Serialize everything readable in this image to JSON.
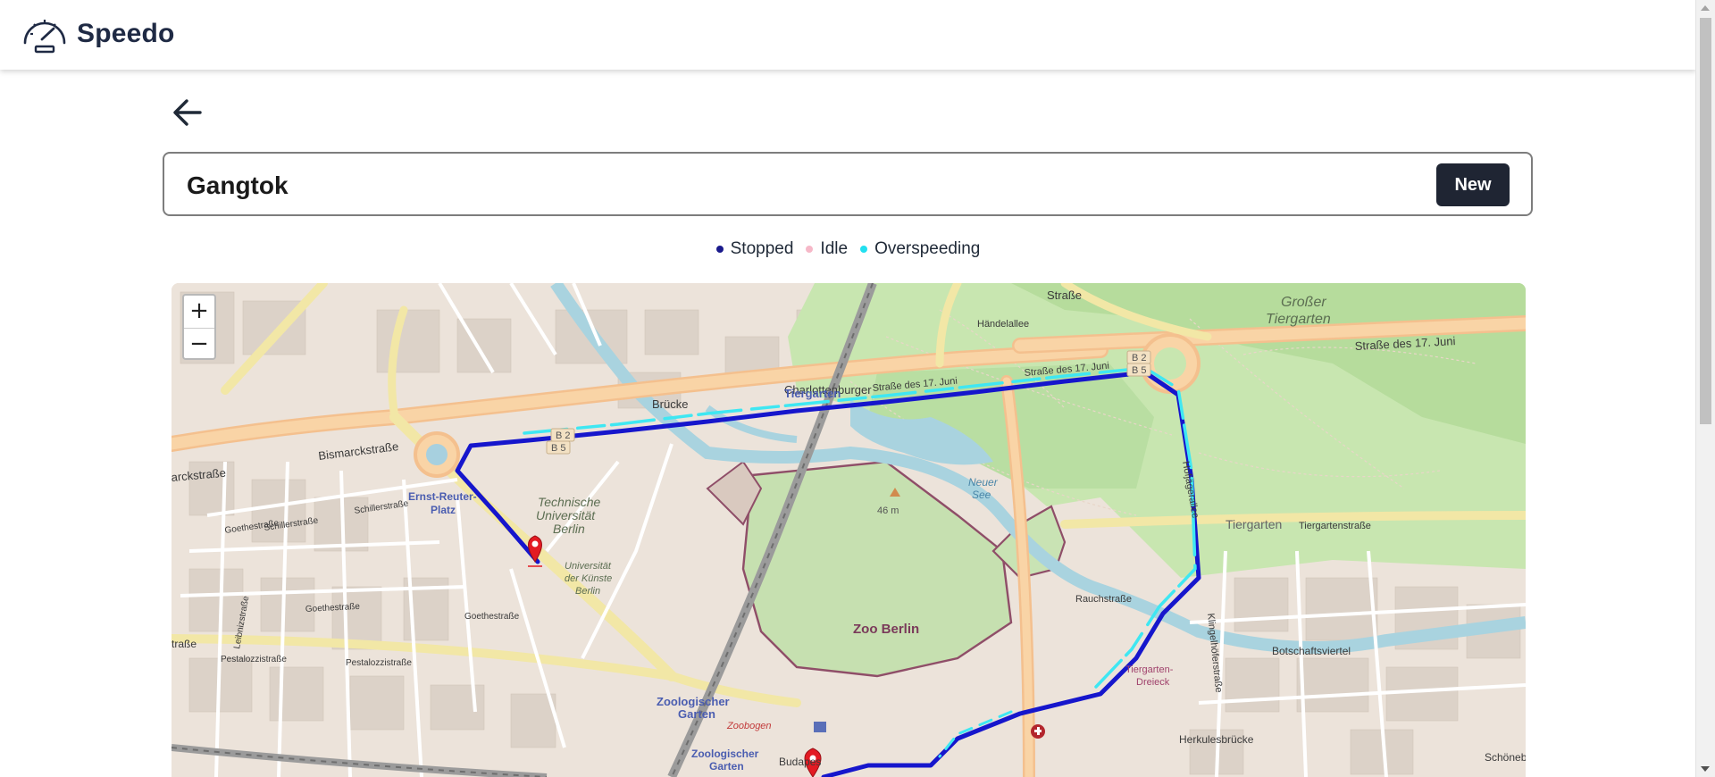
{
  "app": {
    "brand": "Speedo",
    "logo_icon": "speedometer-icon"
  },
  "nav": {
    "back_icon": "arrow-left-icon"
  },
  "search": {
    "value": "Gangtok",
    "new_button": "New"
  },
  "legend": [
    {
      "label": "Stopped",
      "color": "#1a1a8c"
    },
    {
      "label": "Idle",
      "color": "#f6b8c8"
    },
    {
      "label": "Overspeeding",
      "color": "#22e0f0"
    }
  ],
  "map": {
    "zoom_in": "+",
    "zoom_out": "−",
    "route_colors": {
      "stopped": "#0b20c8",
      "overspeeding": "#3ee7f2"
    },
    "marker_color": "#e31b23",
    "labels": {
      "tiergarten_station": "Tiergarten",
      "grosser_tiergarten_1": "Großer",
      "grosser_tiergarten_2": "Tiergarten",
      "str17juni_east": "Straße des 17. Juni",
      "str17juni_mid": "Straße des 17. Juni",
      "str17juni_west": "Straße des 17. Juni",
      "charlottenburger_1": "Charlottenburger",
      "charlottenburger_2": "Brücke",
      "bismarckstr": "Bismarckstraße",
      "bismarckstr_cut": "arckstraße",
      "ernst_reuter_1": "Ernst-Reuter-",
      "ernst_reuter_2": "Platz",
      "tu_1": "Technische",
      "tu_2": "Universität",
      "tu_3": "Berlin",
      "udk_1": "Universität",
      "udk_2": "der Künste",
      "udk_3": "Berlin",
      "neuer_see_1": "Neuer",
      "neuer_see_2": "See",
      "height": "46 m",
      "zoo_berlin": "Zoo Berlin",
      "zoo_garten_1": "Zoologischer",
      "zoo_garten_2": "Garten",
      "zoo_garten_3": "Zoologischer",
      "zoo_garten_4": "Garten",
      "zoobogen": "Zoobogen",
      "tiergarten_district": "Tiergarten",
      "tiergartenstr": "Tiergartenstraße",
      "botschaftsviertel": "Botschaftsviertel",
      "tiergarten_dreieck_1": "Tiergarten-",
      "tiergarten_dreieck_2": "Dreieck",
      "herkulesbrucke": "Herkulesbrücke",
      "schoneberg": "Schöneb",
      "klingelhoferstr": "Klingelhöferstraße",
      "hofjagerallee": "Hofjägerallee",
      "goethestr_1": "Goethestraße",
      "goethestr_2": "Goethestraße",
      "goethestr_3": "Goethestraße",
      "schillerstr_1": "Schillerstraße",
      "schillerstr_2": "Schillerstraße",
      "pestalozzistr_1": "Pestalozzistraße",
      "pestalozzistr_2": "Pestalozzistraße",
      "leibnizstr": "Leibnizstraße",
      "rauchstr": "Rauchstraße",
      "budapester": "Budapes",
      "strasse_cut": "traße",
      "handelallee": "Händelallee",
      "b2": "B 2",
      "b5": "B 5",
      "b2b": "B 2",
      "b5b": "B 5",
      "strasse_top": "Straße"
    }
  }
}
